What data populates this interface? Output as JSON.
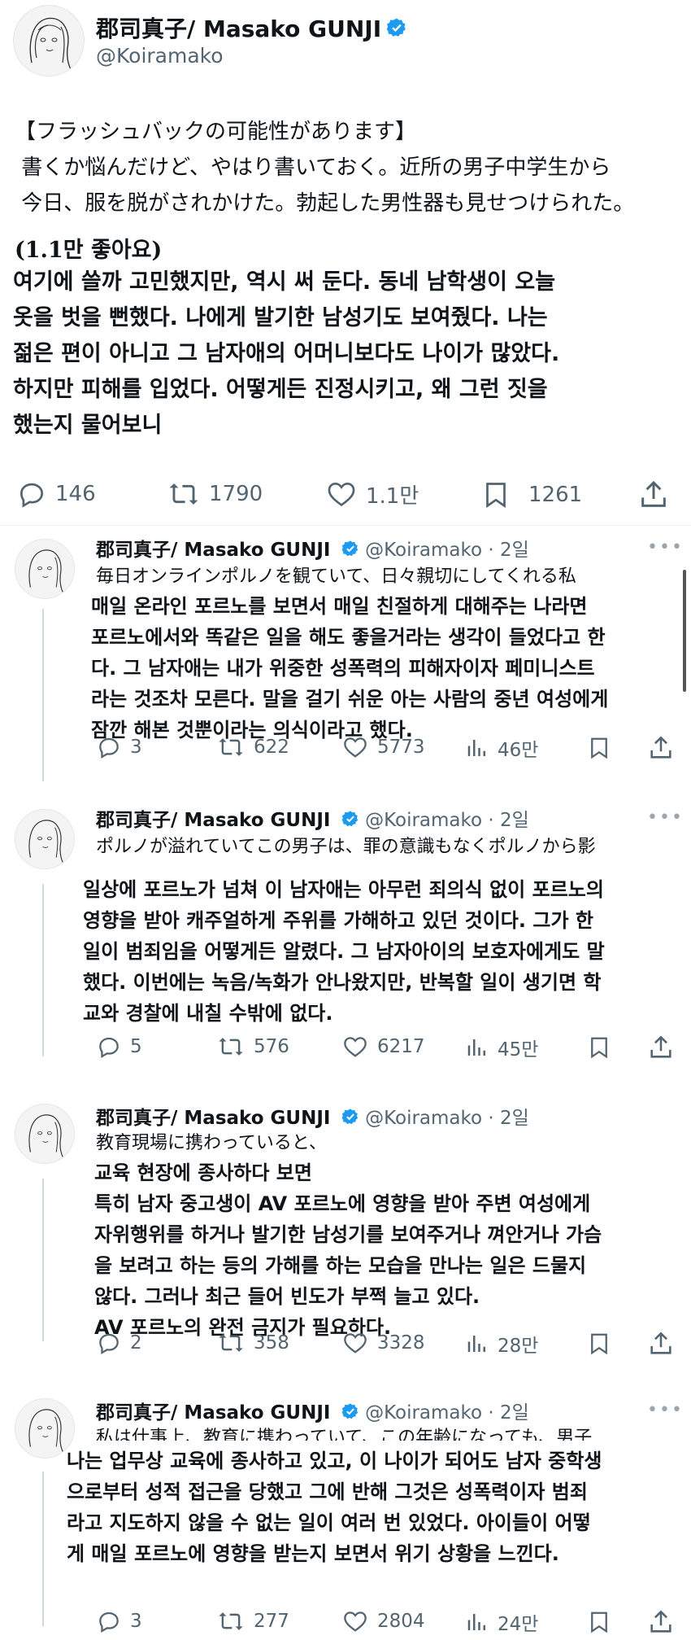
{
  "author": {
    "name": "郡司真子/ Masako GUNJI",
    "handle": "@Koiramako"
  },
  "main_tweet": {
    "jp_lines": "【フラッシュバックの可能性があります】\n 書くか悩んだけど、やはり書いておく。近所の男子中学生から\n 今日、服を脱がされかけた。勃起した男性器も見せつけられた。",
    "likes_caption": "(1.1만 좋아요)",
    "kr_lines": "여기에 쓸까 고민했지만, 역시 써 둔다. 동네 남학생이 오늘\n옷을 벗을 뻔했다. 나에게 발기한 남성기도 보여줬다. 나는\n젊은 편이 아니고 그 남자애의 어머니보다도 나이가 많았다.\n하지만 피해를 입었다. 어떻게든 진정시키고, 왜 그런 짓을\n했는지 물어보니",
    "stats": {
      "replies": "146",
      "retweets": "1790",
      "likes": "1.1만",
      "bookmarks": "1261"
    }
  },
  "replies": [
    {
      "time": "· 2일",
      "jp": "毎日オンラインポルノを観ていて、日々親切にしてくれる私",
      "kr": "매일 온라인 포르노를 보면서 매일 친절하게 대해주는 나라면\n포르노에서와 똑같은 일을 해도 좋을거라는 생각이 들었다고 한\n다. 그 남자애는 내가 위중한 성폭력의 피해자이자 페미니스트\n라는 것조차 모른다. 말을 걸기 쉬운 아는 사람의 중년 여성에게\n잠깐 해본 것뿐이라는 의식이라고 했다.",
      "stats": {
        "replies": "3",
        "retweets": "622",
        "likes": "5773",
        "views": "46만"
      }
    },
    {
      "time": "· 2일",
      "jp": "ポルノが溢れていてこの男子は、罪の意識もなくポルノから影",
      "kr": "일상에 포르노가 넘쳐 이 남자애는 아무런 죄의식 없이 포르노의\n영향을 받아 캐주얼하게 주위를 가해하고 있던 것이다. 그가 한\n일이 범죄임을 어떻게든 알렸다. 그 남자아이의 보호자에게도 말\n했다. 이번에는 녹음/녹화가 안나왔지만, 반복할 일이 생기면 학\n교와 경찰에 내칠 수밖에 없다.",
      "stats": {
        "replies": "5",
        "retweets": "576",
        "likes": "6217",
        "views": "45만"
      }
    },
    {
      "time": "· 2일",
      "jp": "教育現場に携わっていると、",
      "kr": "교육 현장에 종사하다 보면\n특히 남자 중고생이 AV 포르노에 영향을 받아 주변 여성에게\n자위행위를 하거나 발기한 남성기를 보여주거나 껴안거나 가슴\n을 보려고 하는 등의 가해를 하는 모습을 만나는 일은 드물지\n않다. 그러나 최근 들어 빈도가 부쩍 늘고 있다.\nAV 포르노의 완전 금지가 필요하다.",
      "stats": {
        "replies": "2",
        "retweets": "358",
        "likes": "3328",
        "views": "28만"
      }
    },
    {
      "time": "· 2일",
      "jp": "私は仕事上、教育に携わっていて、この年齢になっても、男子",
      "kr": "나는 업무상 교육에 종사하고 있고, 이 나이가 되어도 남자 중학생\n으로부터 성적 접근을 당했고 그에 반해 그것은 성폭력이자 범죄\n라고 지도하지 않을 수 없는 일이 여러 번 있었다. 아이들이 어떻\n게 매일 포르노에 영향을 받는지 보면서 위기 상황을 느낀다.",
      "stats": {
        "replies": "3",
        "retweets": "277",
        "likes": "2804",
        "views": "24만"
      }
    }
  ],
  "colors": {
    "text": "#0f1419",
    "muted": "#536471",
    "verified": "#1d9bf0",
    "line": "#cfd9de"
  },
  "icons": [
    "reply-icon",
    "retweet-icon",
    "like-icon",
    "bookmark-icon",
    "share-icon",
    "views-icon",
    "verified-badge-icon",
    "more-icon"
  ]
}
